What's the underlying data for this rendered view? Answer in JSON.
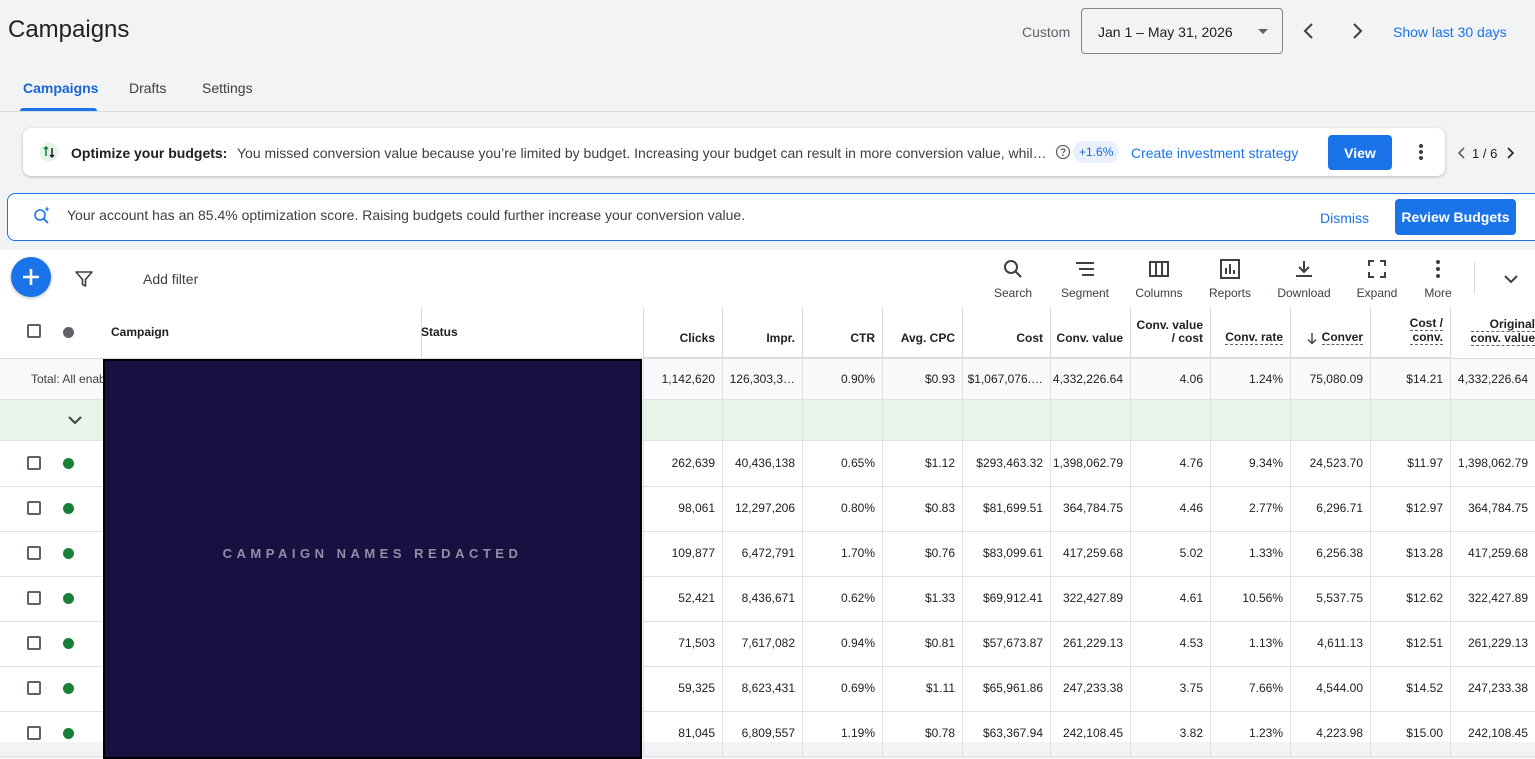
{
  "header": {
    "title": "Campaigns",
    "date_label": "Custom",
    "date_range": "Jan 1 – May 31, 2026",
    "show_last": "Show last 30 days"
  },
  "tabs": [
    {
      "label": "Campaigns",
      "active": true
    },
    {
      "label": "Drafts"
    },
    {
      "label": "Settings"
    }
  ],
  "optimize_banner": {
    "title": "Optimize your budgets:",
    "text": "You missed conversion value because you’re limited by budget. Increasing your budget can result in more conversion value, while maintaining your current ROAS.",
    "uplift": "+1.6%",
    "create_link": "Create investment strategy",
    "view_label": "View",
    "pager": "1 / 6"
  },
  "score_banner": {
    "text": "Your account has an 85.4% optimization score. Raising budgets could further increase your conversion value.",
    "dismiss": "Dismiss",
    "review": "Review Budgets"
  },
  "toolbar": {
    "add_filter": "Add filter",
    "tools": [
      {
        "label": "Search",
        "icon": "search-icon"
      },
      {
        "label": "Segment",
        "icon": "segment-icon"
      },
      {
        "label": "Columns",
        "icon": "columns-icon"
      },
      {
        "label": "Reports",
        "icon": "reports-icon"
      },
      {
        "label": "Download",
        "icon": "download-icon"
      },
      {
        "label": "Expand",
        "icon": "expand-icon"
      },
      {
        "label": "More",
        "icon": "more-vert-icon"
      }
    ]
  },
  "table": {
    "headers": {
      "campaign": "Campaign",
      "status": "Status",
      "clicks": "Clicks",
      "impr": "Impr.",
      "ctr": "CTR",
      "avg_cpc": "Avg. CPC",
      "cost": "Cost",
      "conv_value": "Conv. value",
      "conv_value_cost_1": "Conv. value",
      "conv_value_cost_2": "/ cost",
      "conv_rate": "Conv. rate",
      "conversions": "Conver",
      "cost_conv_1": "Cost /",
      "cost_conv_2": "conv.",
      "orig_conv_value_1": "Original",
      "orig_conv_value_2": "conv. value"
    },
    "total_label": "Total: All enabled campaigns",
    "total": [
      "1,142,620",
      "126,303,3…",
      "0.90%",
      "$0.93",
      "$1,067,076.…",
      "4,332,226.64",
      "4.06",
      "1.24%",
      "75,080.09",
      "$14.21",
      "4,332,226.64"
    ],
    "rows": [
      [
        "262,639",
        "40,436,138",
        "0.65%",
        "$1.12",
        "$293,463.32",
        "1,398,062.79",
        "4.76",
        "9.34%",
        "24,523.70",
        "$11.97",
        "1,398,062.79"
      ],
      [
        "98,061",
        "12,297,206",
        "0.80%",
        "$0.83",
        "$81,699.51",
        "364,784.75",
        "4.46",
        "2.77%",
        "6,296.71",
        "$12.97",
        "364,784.75"
      ],
      [
        "109,877",
        "6,472,791",
        "1.70%",
        "$0.76",
        "$83,099.61",
        "417,259.68",
        "5.02",
        "1.33%",
        "6,256.38",
        "$13.28",
        "417,259.68"
      ],
      [
        "52,421",
        "8,436,671",
        "0.62%",
        "$1.33",
        "$69,912.41",
        "322,427.89",
        "4.61",
        "10.56%",
        "5,537.75",
        "$12.62",
        "322,427.89"
      ],
      [
        "71,503",
        "7,617,082",
        "0.94%",
        "$0.81",
        "$57,673.87",
        "261,229.13",
        "4.53",
        "1.13%",
        "4,611.13",
        "$12.51",
        "261,229.13"
      ],
      [
        "59,325",
        "8,623,431",
        "0.69%",
        "$1.11",
        "$65,961.86",
        "247,233.38",
        "3.75",
        "7.66%",
        "4,544.00",
        "$14.52",
        "247,233.38"
      ],
      [
        "81,045",
        "6,809,557",
        "1.19%",
        "$0.78",
        "$63,367.94",
        "242,108.45",
        "3.82",
        "1.23%",
        "4,223.98",
        "$15.00",
        "242,108.45"
      ]
    ],
    "redaction": "CAMPAIGN NAMES REDACTED"
  },
  "colors": {
    "accent": "#1a73e8",
    "status_enabled": "#188038",
    "redaction_bg": "#161140"
  }
}
